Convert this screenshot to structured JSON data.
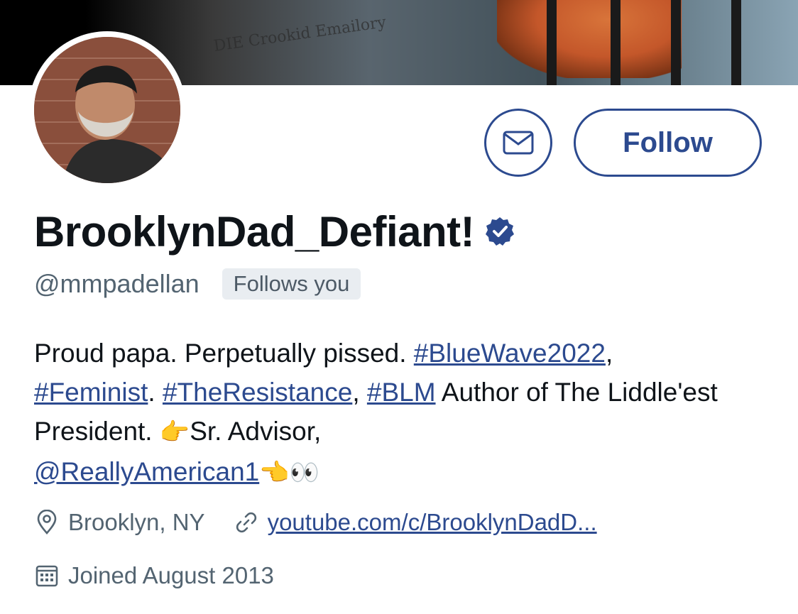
{
  "banner": {
    "cartoon_text": "DIE Crookid Emailory"
  },
  "profile": {
    "display_name": "BrooklynDad_Defiant!",
    "handle": "@mmpadellan",
    "follows_you": "Follows you",
    "verified_icon": "verified-badge-icon"
  },
  "actions": {
    "message_icon": "envelope-icon",
    "follow_label": "Follow"
  },
  "bio": {
    "t1": "Proud papa. Perpetually pissed. ",
    "h1": "#BlueWave2022",
    "t2": ",",
    "h2": "#Feminist",
    "t3": ". ",
    "h3": "#TheResistance",
    "t4": ", ",
    "h4": "#BLM",
    "t5": " Author of The Liddle'est President. ",
    "e1": "👉",
    "t6": "Sr. Advisor,",
    "m1": "@ReallyAmerican1",
    "e2": "👈",
    "e3": "👀"
  },
  "meta": {
    "location": "Brooklyn, NY",
    "location_icon": "location-pin-icon",
    "link": "youtube.com/c/BrooklynDadD...",
    "link_icon": "link-icon",
    "joined": "Joined August 2013",
    "joined_icon": "calendar-icon"
  },
  "colors": {
    "accent": "#2c4a8f",
    "secondary_text": "#536471",
    "badge_bg": "#e9edf1"
  }
}
